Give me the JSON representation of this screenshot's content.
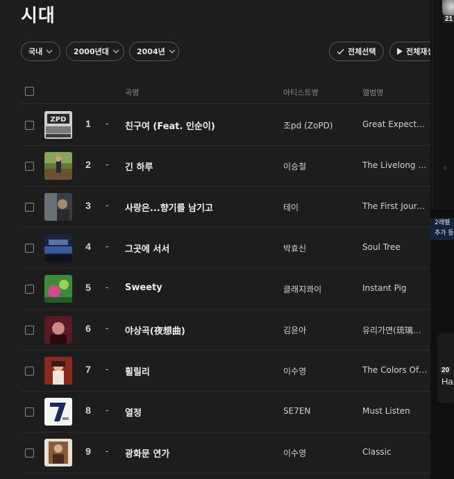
{
  "page": {
    "title": "시대"
  },
  "filters": {
    "region": "국내",
    "decade": "2000년대",
    "year": "2004년",
    "select_all": "전체선택",
    "play_all": "전체재생"
  },
  "table": {
    "headers": {
      "song": "곡명",
      "artist": "아티스트명",
      "album": "앨범명"
    },
    "rows": [
      {
        "rank": "1",
        "change": "-",
        "song": "친구여 (Feat. 인순이)",
        "artist": "조pd (ZoPD)",
        "album": "Great Expectations"
      },
      {
        "rank": "2",
        "change": "-",
        "song": "긴 하루",
        "artist": "이승철",
        "album": "The Livelong Day"
      },
      {
        "rank": "3",
        "change": "-",
        "song": "사랑은...향기를 남기고",
        "artist": "테이",
        "album": "The First Journey"
      },
      {
        "rank": "4",
        "change": "-",
        "song": "그곳에 서서",
        "artist": "박효신",
        "album": "Soul Tree"
      },
      {
        "rank": "5",
        "change": "-",
        "song": "Sweety",
        "artist": "클래지콰이",
        "album": "Instant Pig"
      },
      {
        "rank": "6",
        "change": "-",
        "song": "야상곡(夜想曲)",
        "artist": "김윤아",
        "album": "유리가면(琉璃假面)"
      },
      {
        "rank": "7",
        "change": "-",
        "song": "휠릴리",
        "artist": "이수영",
        "album": "The Colors Of Life"
      },
      {
        "rank": "8",
        "change": "-",
        "song": "열정",
        "artist": "SE7EN",
        "album": "Must Listen"
      },
      {
        "rank": "9",
        "change": "-",
        "song": "광화문 연가",
        "artist": "이수영",
        "album": "Classic"
      }
    ]
  },
  "side": {
    "level_top": "21",
    "promo_line1": "2레벨",
    "promo_line2": "추가 등",
    "level_bottom": "20",
    "name_fragment": "Ha"
  }
}
